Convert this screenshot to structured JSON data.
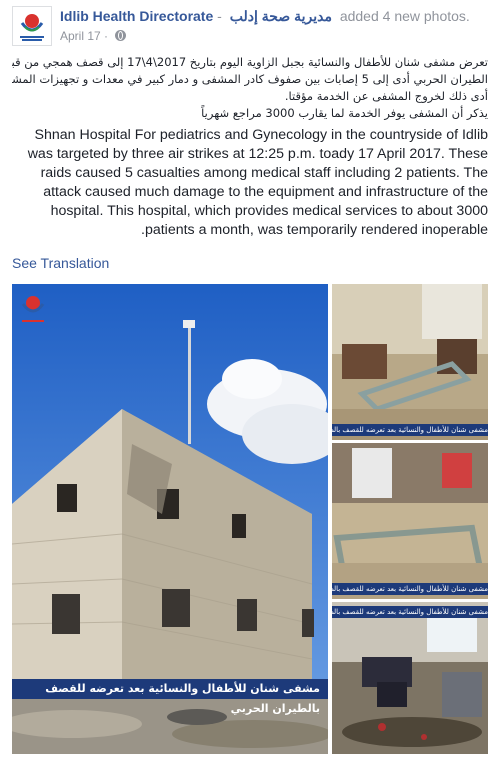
{
  "post": {
    "page_name": "Idlib Health Directorate",
    "separator": "-",
    "page_name_ar": "مديرية صحة إدلب",
    "action": "added 4 new photos.",
    "date": "April 17",
    "ar_line1": "تعرض مشفى شنان للأطفال والنسائية بجبل الزاوية اليوم بتاريخ 2017\\4\\17 إلى قصف همجي من قبل",
    "ar_line2": "الطيران الحربي أدى إلى 5 إصابات بين صفوف كادر المشفى و دمار كبير في معدات و تجهيزات المشفى.",
    "ar_line3": "أدى ذلك لخروج المشفى عن الخدمة مؤقتا.",
    "ar_line4": "يذكر أن المشفى يوفر الخدمة لما يقارب 3000 مراجع شهرياً",
    "en_text": "Shnan Hospital For pediatrics and Gynecology in the countryside of Idlib was targeted by three air strikes at 12:25 p.m. toady 17 April 2017. These raids caused 5 casualties among medical staff including 2 patients. The attack caused much damage to the equipment and infrastructure of the hospital. This hospital, which provides medical services to about 3000 .patients a month, was temporarily rendered inoperable",
    "see_translation": "See Translation"
  },
  "photos": {
    "main_caption": "مشفى شنان للأطفال والنسائية بعد تعرضه للقصف بالطيران الحربي",
    "side_caption": "مشفى شنان للأطفال والنسائية بعد تعرضه للقصف بالطيران الحربي"
  },
  "colors": {
    "link": "#365899",
    "caption_bar": "#1d3a7a",
    "meta": "#90949c"
  }
}
